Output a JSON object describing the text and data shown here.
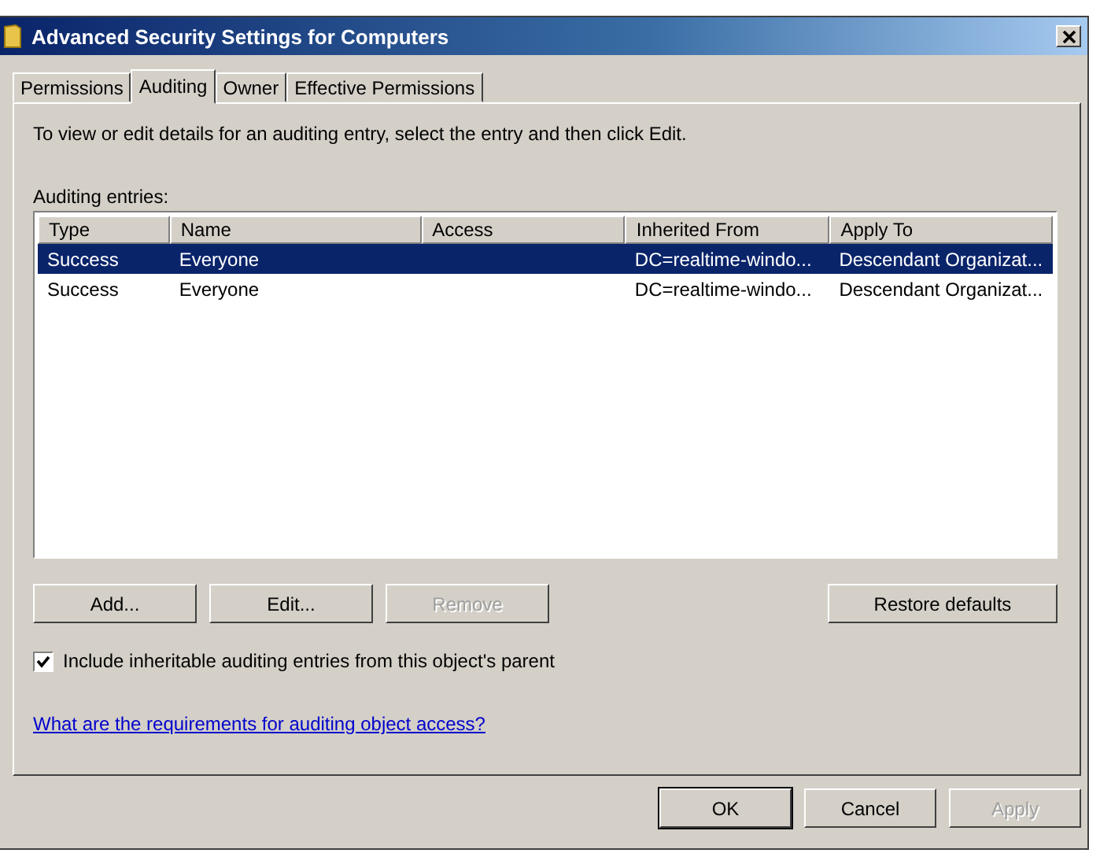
{
  "window": {
    "title": "Advanced Security Settings for Computers"
  },
  "tabs": [
    {
      "label": "Permissions",
      "selected": false
    },
    {
      "label": "Auditing",
      "selected": true
    },
    {
      "label": "Owner",
      "selected": false
    },
    {
      "label": "Effective Permissions",
      "selected": false
    }
  ],
  "instructions": "To view or edit details for an auditing entry, select the entry and then click Edit.",
  "entries_label": "Auditing entries:",
  "table": {
    "columns": [
      "Type",
      "Name",
      "Access",
      "Inherited From",
      "Apply To"
    ],
    "rows": [
      {
        "cells": [
          "Success",
          "Everyone",
          "",
          "DC=realtime-windo...",
          "Descendant Organizat..."
        ],
        "selected": true
      },
      {
        "cells": [
          "Success",
          "Everyone",
          "",
          "DC=realtime-windo...",
          "Descendant Organizat..."
        ],
        "selected": false
      }
    ]
  },
  "entry_buttons": [
    {
      "label": "Add...",
      "disabled": false
    },
    {
      "label": "Edit...",
      "disabled": false
    },
    {
      "label": "Remove",
      "disabled": true
    }
  ],
  "restore_button": {
    "label": "Restore defaults",
    "disabled": false
  },
  "inherit_checkbox": {
    "label": "Include inheritable auditing entries from this object's parent",
    "checked": true
  },
  "help_link": "What are the requirements for auditing object access?",
  "dialog_buttons": [
    {
      "label": "OK",
      "disabled": false,
      "default": true
    },
    {
      "label": "Cancel",
      "disabled": false,
      "default": false
    },
    {
      "label": "Apply",
      "disabled": true,
      "default": false
    }
  ]
}
